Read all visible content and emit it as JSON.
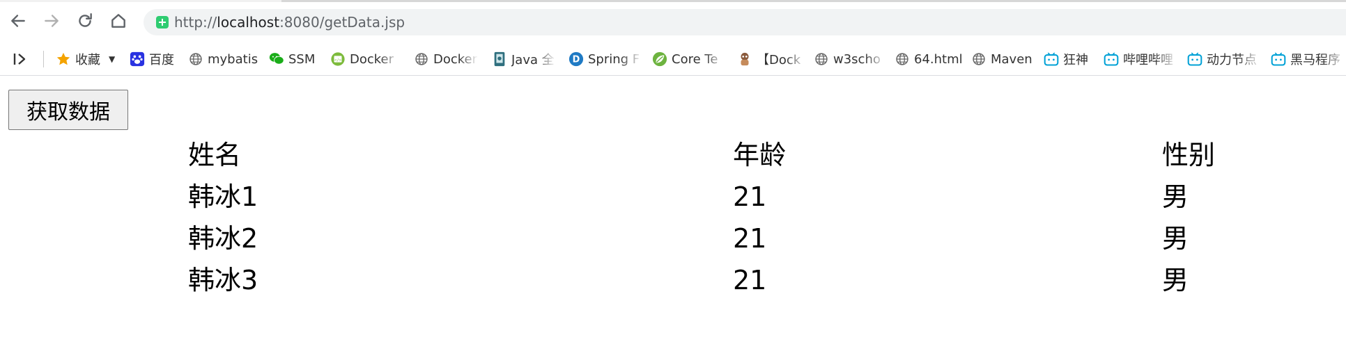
{
  "browser": {
    "url_prefix": "http://",
    "url_host": "localhost",
    "url_rest": ":8080/getData.jsp"
  },
  "bookmarks": [
    {
      "label": "收藏",
      "icon": "star-icon"
    },
    {
      "label": "百度",
      "icon": "baidu-paw-icon"
    },
    {
      "label": "mybatis",
      "icon": "globe-icon"
    },
    {
      "label": "SSM",
      "icon": "wechat-icon"
    },
    {
      "label": "Docker",
      "icon": "docker-page-icon"
    },
    {
      "label": "Docker",
      "icon": "globe-icon"
    },
    {
      "label": "Java 全",
      "icon": "book-icon"
    },
    {
      "label": "Spring F",
      "icon": "d-logo-icon"
    },
    {
      "label": "Core Te",
      "icon": "spring-leaf-icon"
    },
    {
      "label": "【Dock",
      "icon": "avatar-icon"
    },
    {
      "label": "w3scho",
      "icon": "globe-icon"
    },
    {
      "label": "64.html",
      "icon": "globe-icon"
    },
    {
      "label": "Maven",
      "icon": "globe-icon"
    },
    {
      "label": "狂神",
      "icon": "bilibili-icon"
    },
    {
      "label": "哔哩哔哩",
      "icon": "bilibili-icon"
    },
    {
      "label": "动力节点",
      "icon": "bilibili-icon"
    },
    {
      "label": "黑马程序",
      "icon": "bilibili-icon"
    }
  ],
  "page": {
    "button_label": "获取数据",
    "table": {
      "headers": [
        "姓名",
        "年龄",
        "性别"
      ],
      "rows": [
        [
          "韩冰1",
          "21",
          "男"
        ],
        [
          "韩冰2",
          "21",
          "男"
        ],
        [
          "韩冰3",
          "21",
          "男"
        ]
      ]
    }
  },
  "colors": {
    "secure_badge": "#2ecc71",
    "star": "#f4a300",
    "baidu": "#2932e1",
    "wechat": "#1aad19",
    "bilibili": "#00a1d6",
    "spring": "#6db33f",
    "d_logo": "#1f7ac4"
  }
}
